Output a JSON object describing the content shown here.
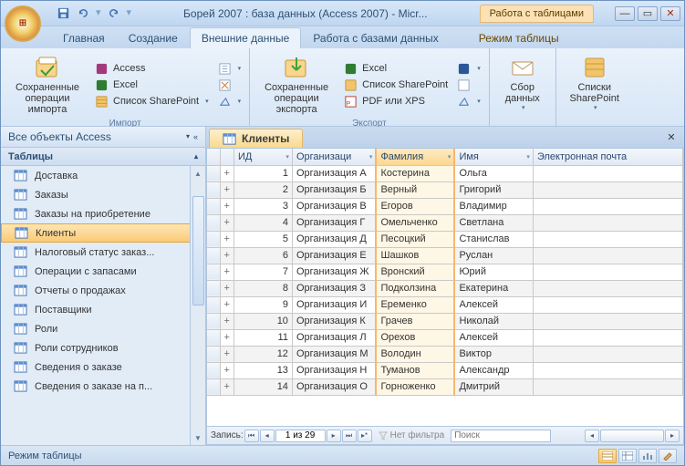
{
  "window": {
    "title": "Борей 2007 : база данных (Access 2007) - Micr...",
    "contextual_tab_group": "Работа с таблицами"
  },
  "qat": {
    "save": "save-icon",
    "undo": "undo-icon",
    "redo": "redo-icon"
  },
  "ribbon_tabs": {
    "home": "Главная",
    "create": "Создание",
    "external_data": "Внешние данные",
    "database_tools": "Работа с базами данных",
    "table_mode": "Режим таблицы"
  },
  "ribbon": {
    "group_import": "Импорт",
    "group_export": "Экспорт",
    "saved_imports": "Сохраненные операции импорта",
    "access": "Access",
    "excel": "Excel",
    "sharepoint_list": "Список SharePoint",
    "saved_exports": "Сохраненные операции экспорта",
    "pdf_xps": "PDF или XPS",
    "collect_data": "Сбор данных",
    "sharepoint_lists": "Списки SharePoint"
  },
  "nav": {
    "title": "Все объекты Access",
    "section": "Таблицы",
    "items": [
      "Доставка",
      "Заказы",
      "Заказы на приобретение",
      "Клиенты",
      "Налоговый статус заказ...",
      "Операции с запасами",
      "Отчеты о продажах",
      "Поставщики",
      "Роли",
      "Роли сотрудников",
      "Сведения о заказе",
      "Сведения о заказе на п..."
    ],
    "selected_index": 3
  },
  "doc_tab": "Клиенты",
  "columns": {
    "id": "ИД",
    "org": "Организаци",
    "lastname": "Фамилия",
    "firstname": "Имя",
    "email": "Электронная почта"
  },
  "rows": [
    {
      "id": 1,
      "org": "Организация А",
      "lastname": "Костерина",
      "firstname": "Ольга"
    },
    {
      "id": 2,
      "org": "Организация Б",
      "lastname": "Верный",
      "firstname": "Григорий"
    },
    {
      "id": 3,
      "org": "Организация В",
      "lastname": "Егоров",
      "firstname": "Владимир"
    },
    {
      "id": 4,
      "org": "Организация Г",
      "lastname": "Омельченко",
      "firstname": "Светлана"
    },
    {
      "id": 5,
      "org": "Организация Д",
      "lastname": "Песоцкий",
      "firstname": "Станислав"
    },
    {
      "id": 6,
      "org": "Организация Е",
      "lastname": "Шашков",
      "firstname": "Руслан"
    },
    {
      "id": 7,
      "org": "Организация Ж",
      "lastname": "Вронский",
      "firstname": "Юрий"
    },
    {
      "id": 8,
      "org": "Организация З",
      "lastname": "Подколзина",
      "firstname": "Екатерина"
    },
    {
      "id": 9,
      "org": "Организация И",
      "lastname": "Еременко",
      "firstname": "Алексей"
    },
    {
      "id": 10,
      "org": "Организация К",
      "lastname": "Грачев",
      "firstname": "Николай"
    },
    {
      "id": 11,
      "org": "Организация Л",
      "lastname": "Орехов",
      "firstname": "Алексей"
    },
    {
      "id": 12,
      "org": "Организация М",
      "lastname": "Володин",
      "firstname": "Виктор"
    },
    {
      "id": 13,
      "org": "Организация Н",
      "lastname": "Туманов",
      "firstname": "Александр"
    },
    {
      "id": 14,
      "org": "Организация О",
      "lastname": "Горноженко",
      "firstname": "Дмитрий"
    }
  ],
  "record_nav": {
    "label": "Запись:",
    "position": "1 из 29",
    "no_filter": "Нет фильтра",
    "search_placeholder": "Поиск"
  },
  "status": {
    "mode": "Режим таблицы"
  }
}
